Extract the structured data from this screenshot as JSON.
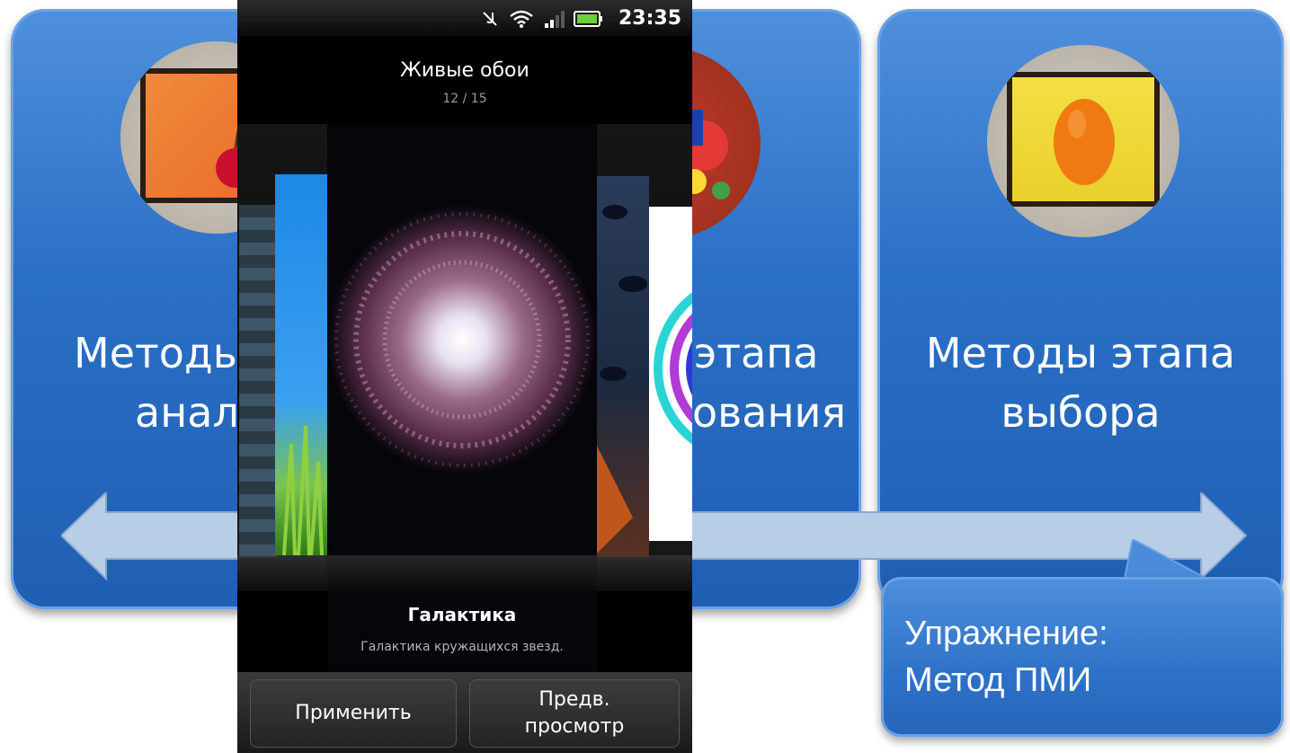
{
  "slide": {
    "cards": [
      {
        "title_line1": "Методы",
        "title_line2": "анал"
      },
      {
        "title_line1": "этапа",
        "title_line2": "ования"
      },
      {
        "title_line1": "Методы этапа",
        "title_line2": "выбора"
      }
    ],
    "callout": {
      "line1": "Упражнение:",
      "line2": "Метод ПМИ"
    },
    "colors": {
      "card_blue": "#2a6fc6",
      "arrow": "#b8cde6"
    }
  },
  "phone": {
    "status_bar": {
      "time": "23:35",
      "icons": [
        "muted-icon",
        "wifi-icon",
        "signal-icon",
        "battery-icon"
      ]
    },
    "header": {
      "title": "Живые обои",
      "counter": "12 / 15"
    },
    "carousel": {
      "items": [
        "tiles-wallpaper",
        "sky-grass-wallpaper",
        "galaxy-wallpaper",
        "leaves-wallpaper",
        "rings-wallpaper"
      ],
      "selected": {
        "name": "Галактика",
        "description": "Галактика кружащихся звезд."
      }
    },
    "buttons": {
      "apply": "Применить",
      "preview_line1": "Предв.",
      "preview_line2": "просмотр"
    }
  }
}
